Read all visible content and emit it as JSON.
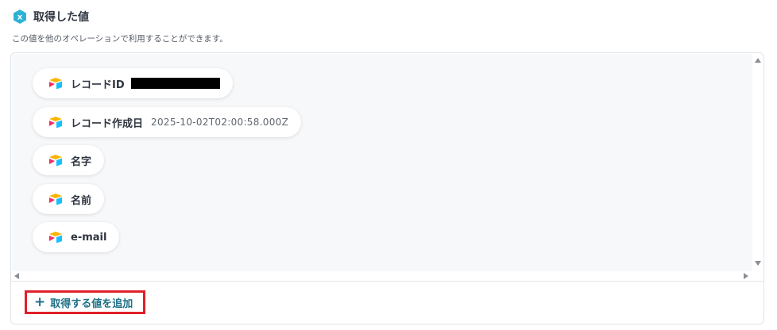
{
  "header": {
    "title": "取得した値",
    "subtitle": "この値を他のオペレーションで利用することができます。",
    "icon": "variable-hex-icon",
    "icon_color": "#2bb3d6"
  },
  "fields": [
    {
      "label": "レコードID",
      "value": "",
      "redacted": true
    },
    {
      "label": "レコード作成日",
      "value": "2025-10-02T02:00:58.000Z"
    },
    {
      "label": "名字",
      "value": ""
    },
    {
      "label": "名前",
      "value": ""
    },
    {
      "label": "e-mail",
      "value": ""
    }
  ],
  "field_icon": "airtable-icon",
  "add_button": {
    "label": "取得する値を追加",
    "icon": "plus-icon",
    "color": "#1f6f86",
    "highlight_color": "#e0202a"
  }
}
